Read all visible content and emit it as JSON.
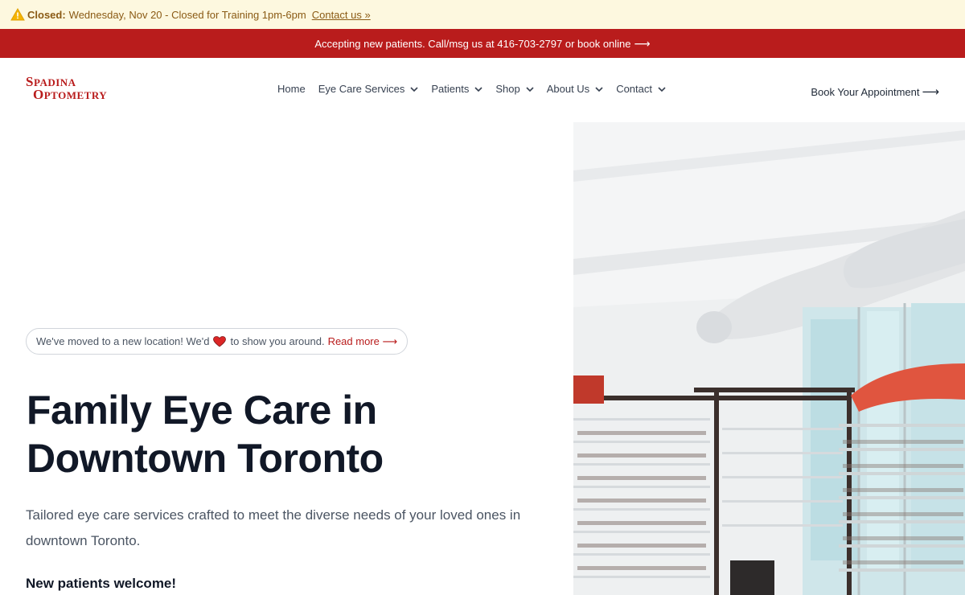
{
  "alert": {
    "strong": "Closed:",
    "text": "Wednesday, Nov 20 - Closed for Training 1pm-6pm",
    "link": "Contact us »",
    "icon": "warning-icon"
  },
  "announcement": {
    "text": "Accepting new patients. Call/msg us at 416-703-2797 or book online",
    "arrow": "⟶"
  },
  "logo": {
    "line1": "Spadina",
    "line2": "Optometry"
  },
  "nav": {
    "items": [
      {
        "label": "Home"
      },
      {
        "label": "Eye Care Services"
      },
      {
        "label": "Patients"
      },
      {
        "label": "Shop"
      },
      {
        "label": "About Us"
      },
      {
        "label": "Contact"
      }
    ]
  },
  "header": {
    "book_label": "Book Your Appointment",
    "book_arrow": "⟶"
  },
  "hero": {
    "pill_text_before": "We've moved to a new location! We'd",
    "pill_text_after": "to show you around.",
    "pill_link": "Read more",
    "pill_arrow": "⟶",
    "title_line1": "Family Eye Care in",
    "title_line2": "Downtown Toronto",
    "lead": "Tailored eye care services crafted to meet the diverse needs of your loved ones in downtown Toronto.",
    "new_patients": "New patients welcome!"
  },
  "colors": {
    "brand": "#b91c1c",
    "alert_bg": "#fdf8df",
    "alert_text": "#8a5a14"
  }
}
